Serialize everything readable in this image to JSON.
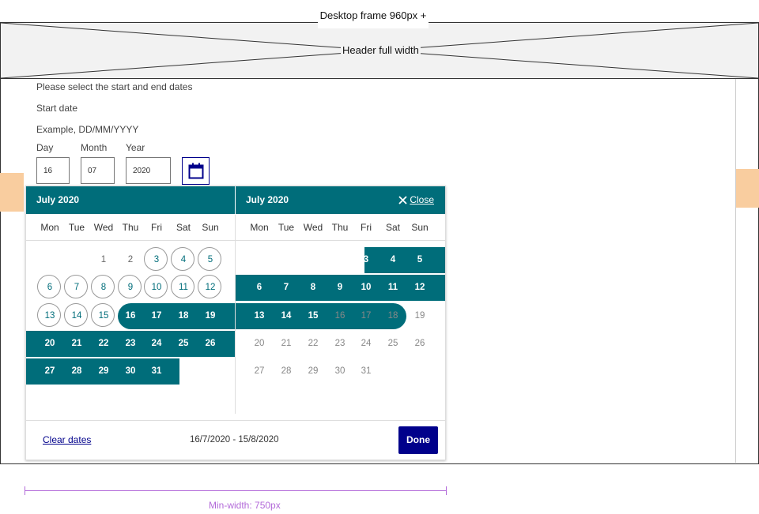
{
  "wireframe": {
    "frame_label": "Desktop frame 960px +",
    "header_label": "Header full width",
    "min_width_label": "Min-width: 750px"
  },
  "form": {
    "prompt": "Please select the start and end dates",
    "start_label": "Start date",
    "hint": "Example, DD/MM/YYYY",
    "day_label": "Day",
    "month_label": "Month",
    "year_label": "Year",
    "day_value": "16",
    "month_value": "07",
    "year_value": "2020",
    "calendar_icon": "calendar-icon"
  },
  "picker": {
    "left_month": "July 2020",
    "right_month": "July 2020",
    "close_label": "Close",
    "weekdays": [
      "Mon",
      "Tue",
      "Wed",
      "Thu",
      "Fri",
      "Sat",
      "Sun"
    ],
    "clear_label": "Clear dates",
    "range_text": "16/7/2020 - 15/8/2020",
    "done_label": "Done",
    "accent_color": "#006d7a",
    "primary_color": "#00008b"
  }
}
